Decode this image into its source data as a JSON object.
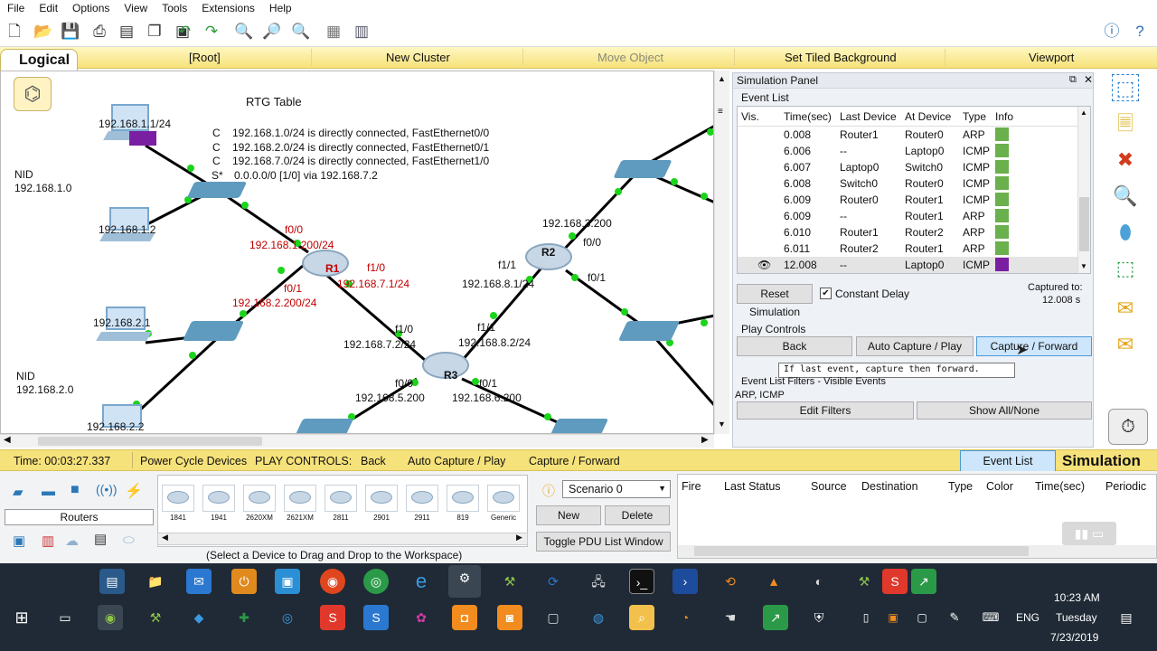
{
  "menu": [
    "File",
    "Edit",
    "Options",
    "View",
    "Tools",
    "Extensions",
    "Help"
  ],
  "nav": {
    "logical_tab": "Logical",
    "root": "[Root]",
    "new_cluster": "New Cluster",
    "move_object": "Move Object",
    "set_tiled_background": "Set Tiled Background",
    "viewport": "Viewport"
  },
  "topology": {
    "rtg_title": "RTG Table",
    "rtg_rows": [
      {
        "code": "C",
        "text": "192.168.1.0/24 is directly connected, FastEthernet0/0"
      },
      {
        "code": "C",
        "text": "192.168.2.0/24 is directly connected, FastEthernet0/1"
      },
      {
        "code": "C",
        "text": "192.168.7.0/24 is directly connected, FastEthernet1/0"
      },
      {
        "code": "S*",
        "text": "0.0.0.0/0 [1/0] via 192.168.7.2"
      }
    ],
    "labels": {
      "pc1": "192.168.1.1/24",
      "nid1_title": "NID",
      "nid1_addr": "192.168.1.0",
      "pc2": "192.168.1.2",
      "r1_f00": "f0/0",
      "r1_f00_ip": "192.168.1.200/24",
      "r1_name": "R1",
      "r1_f10": "f1/0",
      "r1_f10_ip": "192.168.7.1/24",
      "r1_f01": "f0/1",
      "r1_f01_ip": "192.168.2.200/24",
      "pc3": "192.168.2.1",
      "nid2_title": "NID",
      "nid2_addr": "192.168.2.0",
      "pc4": "192.168.2.2",
      "r3_f10": "f1/0",
      "r3_f10_ip": "192.168.7.2/24",
      "r3_f11": "f1/1",
      "r3_f11_ip": "192.168.8.2/24",
      "r3_name": "R3",
      "r3_f00": "f0/0",
      "r3_f00_ip": "192.168.5.200",
      "r3_f01": "f0/1",
      "r3_f01_ip": "192.168.6.200",
      "r2_ip": "192.168.3.200",
      "r2_name": "R2",
      "r2_f00": "f0/0",
      "r2_f11": "f1/1",
      "r2_f11_ip": "192.168.8.1/24",
      "r2_f01": "f0/1"
    }
  },
  "sim": {
    "panel_title": "Simulation Panel",
    "event_list_title": "Event List",
    "columns": [
      "Vis.",
      "Time(sec)",
      "Last Device",
      "At Device",
      "Type",
      "Info"
    ],
    "events": [
      {
        "time": "0.008",
        "last": "Router1",
        "at": "Router0",
        "type": "ARP",
        "color": "#6ab04c"
      },
      {
        "time": "6.006",
        "last": "--",
        "at": "Laptop0",
        "type": "ICMP",
        "color": "#6ab04c"
      },
      {
        "time": "6.007",
        "last": "Laptop0",
        "at": "Switch0",
        "type": "ICMP",
        "color": "#6ab04c"
      },
      {
        "time": "6.008",
        "last": "Switch0",
        "at": "Router0",
        "type": "ICMP",
        "color": "#6ab04c"
      },
      {
        "time": "6.009",
        "last": "Router0",
        "at": "Router1",
        "type": "ICMP",
        "color": "#6ab04c"
      },
      {
        "time": "6.009",
        "last": "--",
        "at": "Router1",
        "type": "ARP",
        "color": "#6ab04c"
      },
      {
        "time": "6.010",
        "last": "Router1",
        "at": "Router2",
        "type": "ARP",
        "color": "#6ab04c"
      },
      {
        "time": "6.011",
        "last": "Router2",
        "at": "Router1",
        "type": "ARP",
        "color": "#6ab04c"
      },
      {
        "time": "12.008",
        "last": "--",
        "at": "Laptop0",
        "type": "ICMP",
        "color": "#7a1fa2"
      }
    ],
    "reset": "Reset Simulation",
    "constant_delay": "Constant Delay",
    "captured_to": "Captured to:",
    "captured_value": "12.008 s",
    "play_controls": "Play Controls",
    "back": "Back",
    "auto_capture": "Auto Capture / Play",
    "capture_forward": "Capture / Forward",
    "tooltip": "If last event, capture then forward.",
    "filters_title": "Event List Filters - Visible Events",
    "filters_value": "ARP, ICMP",
    "edit_filters": "Edit Filters",
    "show_all": "Show All/None"
  },
  "status": {
    "time": "Time: 00:03:27.337",
    "power_cycle": "Power Cycle Devices",
    "play_controls": "PLAY CONTROLS:",
    "back": "Back",
    "auto": "Auto Capture / Play",
    "forward": "Capture / Forward",
    "event_list": "Event List",
    "simulation": "Simulation"
  },
  "devices": {
    "category": "Routers",
    "models": [
      "1841",
      "1941",
      "2620XM",
      "2621XM",
      "2811",
      "2901",
      "2911",
      "819",
      "Generic"
    ],
    "hint": "(Select a Device to Drag and Drop to the Workspace)"
  },
  "scenario": {
    "selected": "Scenario 0",
    "new": "New",
    "delete": "Delete",
    "toggle": "Toggle PDU List Window"
  },
  "pdu_columns": [
    "Fire",
    "Last Status",
    "Source",
    "Destination",
    "Type",
    "Color",
    "Time(sec)",
    "Periodic"
  ],
  "tray": {
    "time": "10:23 AM",
    "day": "Tuesday",
    "date": "7/23/2019",
    "lang": "ENG"
  }
}
